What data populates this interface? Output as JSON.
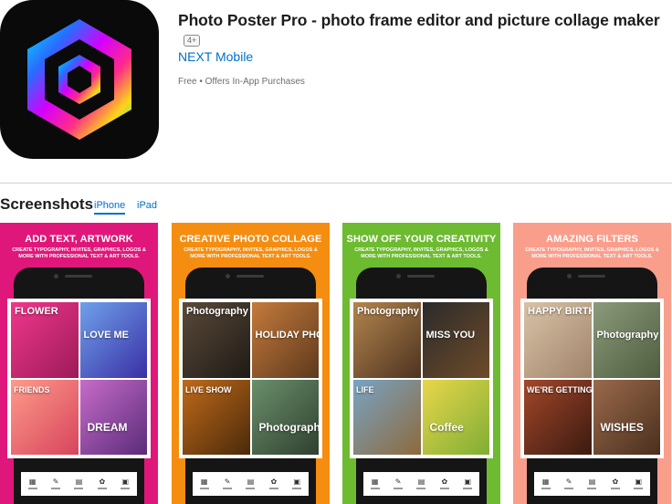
{
  "app": {
    "title": "Photo Poster Pro - photo frame editor and picture collage maker",
    "age_rating": "4+",
    "developer": "NEXT Mobile",
    "price": "Free • Offers In-App Purchases",
    "icon": "hexagon-app-icon"
  },
  "screenshots": {
    "heading": "Screenshots",
    "tabs": [
      {
        "label": "iPhone",
        "selected": true
      },
      {
        "label": "iPad",
        "selected": false
      }
    ],
    "cards": [
      {
        "headline": "ADD TEXT, ARTWORK",
        "subtitle": "CREATE TYPOGRAPHY, INVITES, GRAPHICS, LOGOS & MORE WITH PROFESSIONAL TEXT & ART TOOLS.",
        "bg": "#e0177a",
        "cells": [
          {
            "text": "FLOWER",
            "colors": [
              "#f0378c",
              "#9c1b58"
            ]
          },
          {
            "text": "LOVE ME",
            "colors": [
              "#6fa1ea",
              "#3a2fa6"
            ]
          },
          {
            "text": "FRIENDS",
            "colors": [
              "#ff9a8a",
              "#d6455c"
            ]
          },
          {
            "text": "DREAM",
            "colors": [
              "#c66cc9",
              "#5b2b7a"
            ]
          }
        ]
      },
      {
        "headline": "CREATIVE PHOTO COLLAGE",
        "subtitle": "CREATE TYPOGRAPHY, INVITES, GRAPHICS, LOGOS & MORE WITH PROFESSIONAL TEXT & ART TOOLS.",
        "bg": "#f58d10",
        "cells": [
          {
            "text": "Photography",
            "colors": [
              "#5a4a3a",
              "#1f1a15"
            ]
          },
          {
            "text": "HOLIDAY PHOTO",
            "colors": [
              "#c57a3c",
              "#5d3a1c"
            ]
          },
          {
            "text": "LIVE SHOW",
            "colors": [
              "#c06a1a",
              "#4a2a0a"
            ]
          },
          {
            "text": "Photography",
            "colors": [
              "#6b8f6a",
              "#2f4030"
            ]
          }
        ]
      },
      {
        "headline": "SHOW OFF YOUR CREATIVITY",
        "subtitle": "CREATE TYPOGRAPHY, INVITES, GRAPHICS, LOGOS & MORE WITH PROFESSIONAL TEXT & ART TOOLS.",
        "bg": "#6dbb30",
        "cells": [
          {
            "text": "Photography",
            "colors": [
              "#b3854e",
              "#4d3320"
            ]
          },
          {
            "text": "MISS YOU",
            "colors": [
              "#2b2b2b",
              "#6e4b2a"
            ]
          },
          {
            "text": "LIFE",
            "colors": [
              "#79a3c4",
              "#8d6a3c"
            ]
          },
          {
            "text": "Coffee",
            "colors": [
              "#e9d64a",
              "#7fae35"
            ]
          }
        ]
      },
      {
        "headline": "AMAZING FILTERS",
        "subtitle": "CREATE TYPOGRAPHY, INVITES, GRAPHICS, LOGOS & MORE WITH PROFESSIONAL TEXT & ART TOOLS.",
        "bg": "#fa9e8c",
        "cells": [
          {
            "text": "HAPPY BIRTHDAY",
            "colors": [
              "#d8c3a7",
              "#a0836a"
            ]
          },
          {
            "text": "Photography",
            "colors": [
              "#8a9a7a",
              "#4d5d3d"
            ]
          },
          {
            "text": "WE'RE GETTING MARRIED",
            "colors": [
              "#a4472a",
              "#3a1a10"
            ]
          },
          {
            "text": "WISHES",
            "colors": [
              "#9a6a4a",
              "#4a2f1e"
            ]
          }
        ]
      }
    ],
    "toolbar_icons": [
      "collage-icon",
      "magic-wand-icon",
      "grid-icon",
      "paw-icon",
      "text-icon"
    ]
  }
}
